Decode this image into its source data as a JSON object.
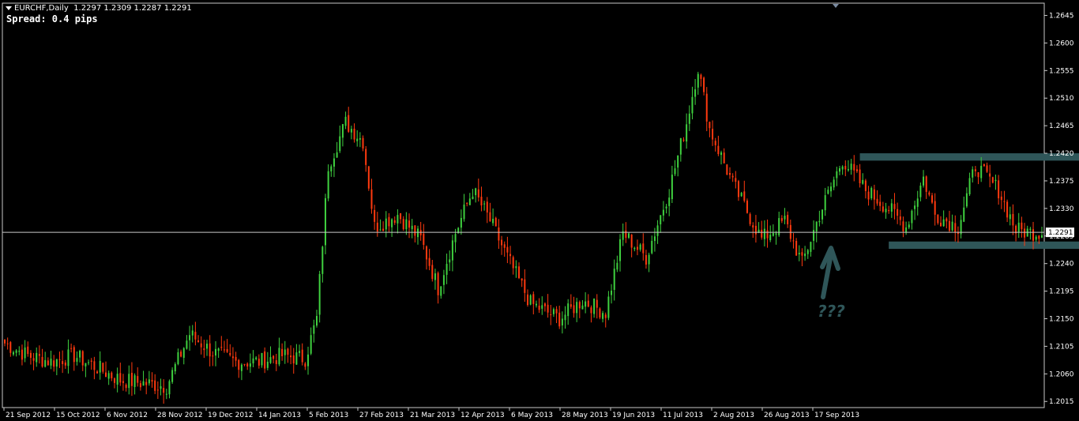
{
  "header": {
    "symbol": "EURCHF,Daily",
    "ohlc": "1.2297 1.2309 1.2287 1.2291",
    "spread": "Spread: 0.4 pips"
  },
  "annotation": {
    "text": "???"
  },
  "colors": {
    "bull": "#3fd13f",
    "bear": "#ff3a0f",
    "zone": "#2f5659",
    "grid": "#c8c8c8"
  },
  "chart_data": {
    "type": "candlestick",
    "title": "",
    "ylim": [
      1.2005,
      1.2665
    ],
    "yticks": [
      "1.2645",
      "1.2600",
      "1.2555",
      "1.2510",
      "1.2465",
      "1.2420",
      "1.2375",
      "1.2330",
      "1.2285",
      "1.2240",
      "1.2195",
      "1.2150",
      "1.2105",
      "1.2060",
      "1.2015"
    ],
    "current_price": "1.2291",
    "xticks": [
      "21 Sep 2012",
      "15 Oct 2012",
      "6 Nov 2012",
      "28 Nov 2012",
      "19 Dec 2012",
      "14 Jan 2013",
      "5 Feb 2013",
      "27 Feb 2013",
      "21 Mar 2013",
      "12 Apr 2013",
      "6 May 2013",
      "28 May 2013",
      "19 Jun 2013",
      "11 Jul 2013",
      "2 Aug 2013",
      "26 Aug 2013",
      "17 Sep 2013"
    ],
    "anchors": [
      [
        0,
        1.211
      ],
      [
        8,
        1.209
      ],
      [
        16,
        1.208
      ],
      [
        24,
        1.209
      ],
      [
        32,
        1.207
      ],
      [
        40,
        1.205
      ],
      [
        48,
        1.2045
      ],
      [
        56,
        1.204
      ],
      [
        64,
        1.2125
      ],
      [
        72,
        1.2095
      ],
      [
        80,
        1.208
      ],
      [
        88,
        1.208
      ],
      [
        96,
        1.209
      ],
      [
        104,
        1.2085
      ],
      [
        108,
        1.215
      ],
      [
        112,
        1.24
      ],
      [
        118,
        1.247
      ],
      [
        124,
        1.244
      ],
      [
        128,
        1.23
      ],
      [
        136,
        1.232
      ],
      [
        144,
        1.228
      ],
      [
        150,
        1.22
      ],
      [
        156,
        1.229
      ],
      [
        162,
        1.236
      ],
      [
        168,
        1.231
      ],
      [
        174,
        1.225
      ],
      [
        182,
        1.2175
      ],
      [
        192,
        1.215
      ],
      [
        200,
        1.218
      ],
      [
        208,
        1.216
      ],
      [
        214,
        1.229
      ],
      [
        222,
        1.225
      ],
      [
        230,
        1.236
      ],
      [
        236,
        1.247
      ],
      [
        240,
        1.256
      ],
      [
        244,
        1.246
      ],
      [
        252,
        1.237
      ],
      [
        262,
        1.228
      ],
      [
        270,
        1.231
      ],
      [
        276,
        1.224
      ],
      [
        282,
        1.232
      ],
      [
        290,
        1.241
      ],
      [
        298,
        1.236
      ],
      [
        306,
        1.233
      ],
      [
        312,
        1.23
      ],
      [
        318,
        1.238
      ],
      [
        322,
        1.232
      ],
      [
        330,
        1.23
      ],
      [
        336,
        1.24
      ],
      [
        344,
        1.236
      ],
      [
        350,
        1.2295
      ],
      [
        355,
        1.2291
      ]
    ],
    "zones": [
      {
        "x_start": 296,
        "x_end": 476,
        "low": 1.2408,
        "high": 1.242
      },
      {
        "x_start": 306,
        "x_end": 478,
        "low": 1.2264,
        "high": 1.2276
      }
    ]
  }
}
